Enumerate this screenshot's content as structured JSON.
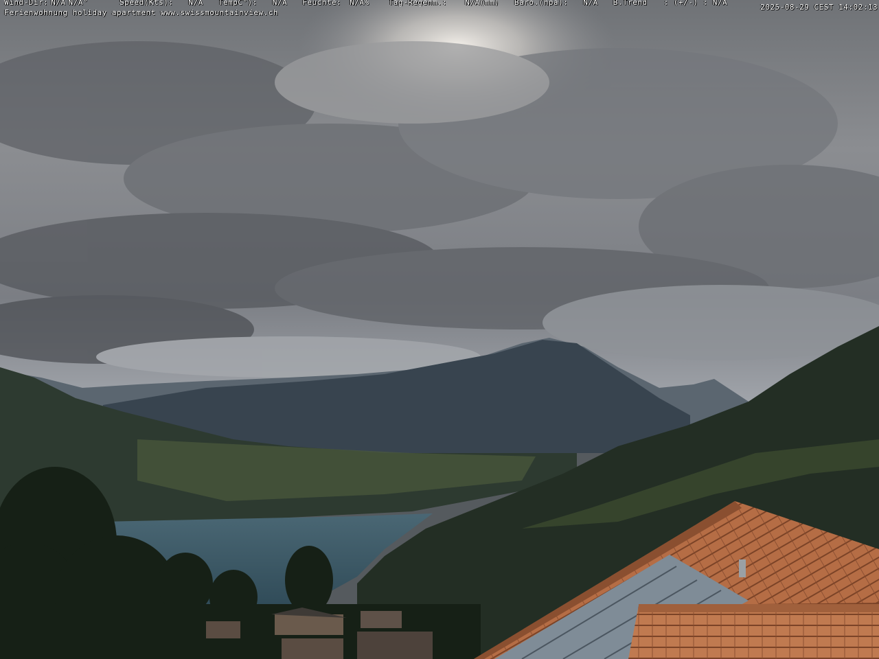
{
  "weather_bar": {
    "wind_dir": {
      "label": "Wind-Dir:",
      "value": "N/A",
      "degrees": "N/A°"
    },
    "speed": {
      "label": "Speed(Kts):",
      "value": "N/A"
    },
    "temp": {
      "label": "TempC°):",
      "value": "N/A"
    },
    "humidity": {
      "label": "Feuchte:",
      "value": "N/A%"
    },
    "rain": {
      "label": "Tag-Regenm.:",
      "value": "N/A(mm)"
    },
    "baro": {
      "label": "Baro.(hpa):",
      "value": "N/A"
    },
    "trend": {
      "label": "B.Trend",
      "value": ": (+/-) : N/A"
    }
  },
  "caption": "Ferienwohnung holiday apartment www.swissmountainview.ch",
  "timestamp": "2025-08-29 CEST 14:02:13",
  "colors": {
    "sky": "#8a8c90",
    "cloud_dark": "#4f5257",
    "lake": "#3c5866",
    "mountain": "#34404a",
    "forest": "#1f2a20",
    "roof": "#c07a50"
  }
}
